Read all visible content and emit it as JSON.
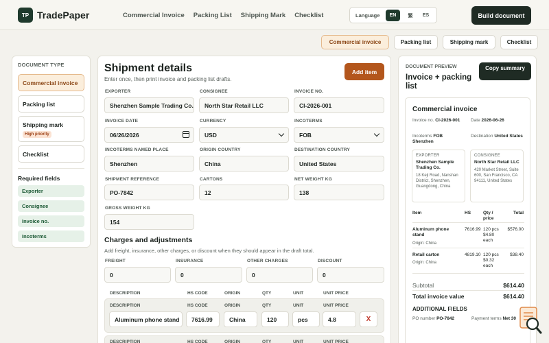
{
  "app": {
    "logo": "TP",
    "name": "TradePaper"
  },
  "nav": [
    "Commercial Invoice",
    "Packing List",
    "Shipping Mark",
    "Checklist"
  ],
  "language": {
    "label": "Language",
    "options": [
      "EN",
      "繁",
      "ES"
    ],
    "selected": "EN"
  },
  "build_label": "Build document",
  "doc_tabs": [
    "Commercial invoice",
    "Packing list",
    "Shipping mark",
    "Checklist"
  ],
  "sidebar": {
    "heading": "DOCUMENT TYPE",
    "items": [
      {
        "label": "Commercial invoice"
      },
      {
        "label": "Packing list"
      },
      {
        "label": "Shipping mark",
        "badge": "High priority"
      },
      {
        "label": "Checklist"
      }
    ],
    "required_heading": "Required fields",
    "required": [
      "Exporter",
      "Consignee",
      "Invoice no.",
      "Incoterms"
    ]
  },
  "main": {
    "title": "Shipment details",
    "subtitle": "Enter once, then print invoice and packing list drafts.",
    "add_item": "Add item",
    "fields": {
      "exporter": {
        "label": "EXPORTER",
        "value": "Shenzhen Sample Trading Co."
      },
      "consignee": {
        "label": "CONSIGNEE",
        "value": "North Star Retail LLC"
      },
      "invoice_no": {
        "label": "INVOICE NO.",
        "value": "CI-2026-001"
      },
      "invoice_date": {
        "label": "INVOICE DATE",
        "value": "06/26/2026"
      },
      "currency": {
        "label": "CURRENCY",
        "value": "USD"
      },
      "incoterms": {
        "label": "INCOTERMS",
        "value": "FOB"
      },
      "named_place": {
        "label": "INCOTERMS NAMED PLACE",
        "value": "Shenzhen"
      },
      "origin_country": {
        "label": "ORIGIN COUNTRY",
        "value": "China"
      },
      "destination_country": {
        "label": "DESTINATION COUNTRY",
        "value": "United States"
      },
      "shipment_reference": {
        "label": "SHIPMENT REFERENCE",
        "value": "PO-7842"
      },
      "cartons": {
        "label": "CARTONS",
        "value": "12"
      },
      "net_weight": {
        "label": "NET WEIGHT KG",
        "value": "138"
      },
      "gross_weight": {
        "label": "GROSS WEIGHT KG",
        "value": "154"
      }
    },
    "charges": {
      "heading": "Charges and adjustments",
      "subtitle": "Add freight, insurance, other charges, or discount when they should appear in the draft total.",
      "freight": {
        "label": "FREIGHT",
        "value": "0"
      },
      "insurance": {
        "label": "INSURANCE",
        "value": "0"
      },
      "other": {
        "label": "OTHER CHARGES",
        "value": "0"
      },
      "discount": {
        "label": "DISCOUNT",
        "value": "0"
      }
    },
    "item_columns": [
      "DESCRIPTION",
      "HS CODE",
      "ORIGIN",
      "QTY",
      "UNIT",
      "UNIT PRICE"
    ],
    "item": {
      "description": "Aluminum phone stand",
      "hs_code": "7616.99",
      "origin": "China",
      "qty": "120",
      "unit": "pcs",
      "unit_price": "4.8",
      "remove": "X"
    }
  },
  "preview": {
    "heading": "DOCUMENT PREVIEW",
    "title": "Invoice + packing list",
    "copy": "Copy summary",
    "doc_title": "Commercial invoice",
    "invoice_label": "Invoice no.",
    "invoice_value": "CI-2026-001",
    "date_label": "Date",
    "date_value": "2026-06-26",
    "incoterms_label": "Incoterms",
    "incoterms_value": "FOB Shenzhen",
    "destination_label": "Destination",
    "destination_value": "United States",
    "exporter": {
      "heading": "EXPORTER",
      "name": "Shenzhen Sample Trading Co.",
      "address": "18 Keji Road, Nanshan District, Shenzhen, Guangdong, China"
    },
    "consignee": {
      "heading": "CONSIGNEE",
      "name": "North Star Retail LLC",
      "address": "420 Market Street, Suite 600, San Francisco, CA 94111, United States"
    },
    "columns": {
      "item": "Item",
      "hs": "HS",
      "qty": "Qty / price",
      "total": "Total"
    },
    "rows": [
      {
        "item": "Aluminum phone stand",
        "origin": "Origin: China",
        "hs": "7616.99",
        "qty": "120 pcs",
        "price": "$4.80",
        "each": "each",
        "total": "$576.00"
      },
      {
        "item": "Retail carton",
        "origin": "Origin: China",
        "hs": "4819.10",
        "qty": "120 pcs",
        "price": "$0.32",
        "each": "each",
        "total": "$38.40"
      }
    ],
    "subtotal_label": "Subtotal",
    "subtotal_value": "$614.40",
    "total_label": "Total invoice value",
    "total_value": "$614.40",
    "additional": "ADDITIONAL FIELDS",
    "po_label": "PO number",
    "po_value": "PO-7842",
    "payment_label": "Payment terms",
    "payment_value": "Net 30"
  },
  "colors": {
    "brand": "#1f3a2d",
    "accent": "#b3561c",
    "active_tab_bg": "#fbeedc",
    "required_bg": "#e6f1e8"
  }
}
